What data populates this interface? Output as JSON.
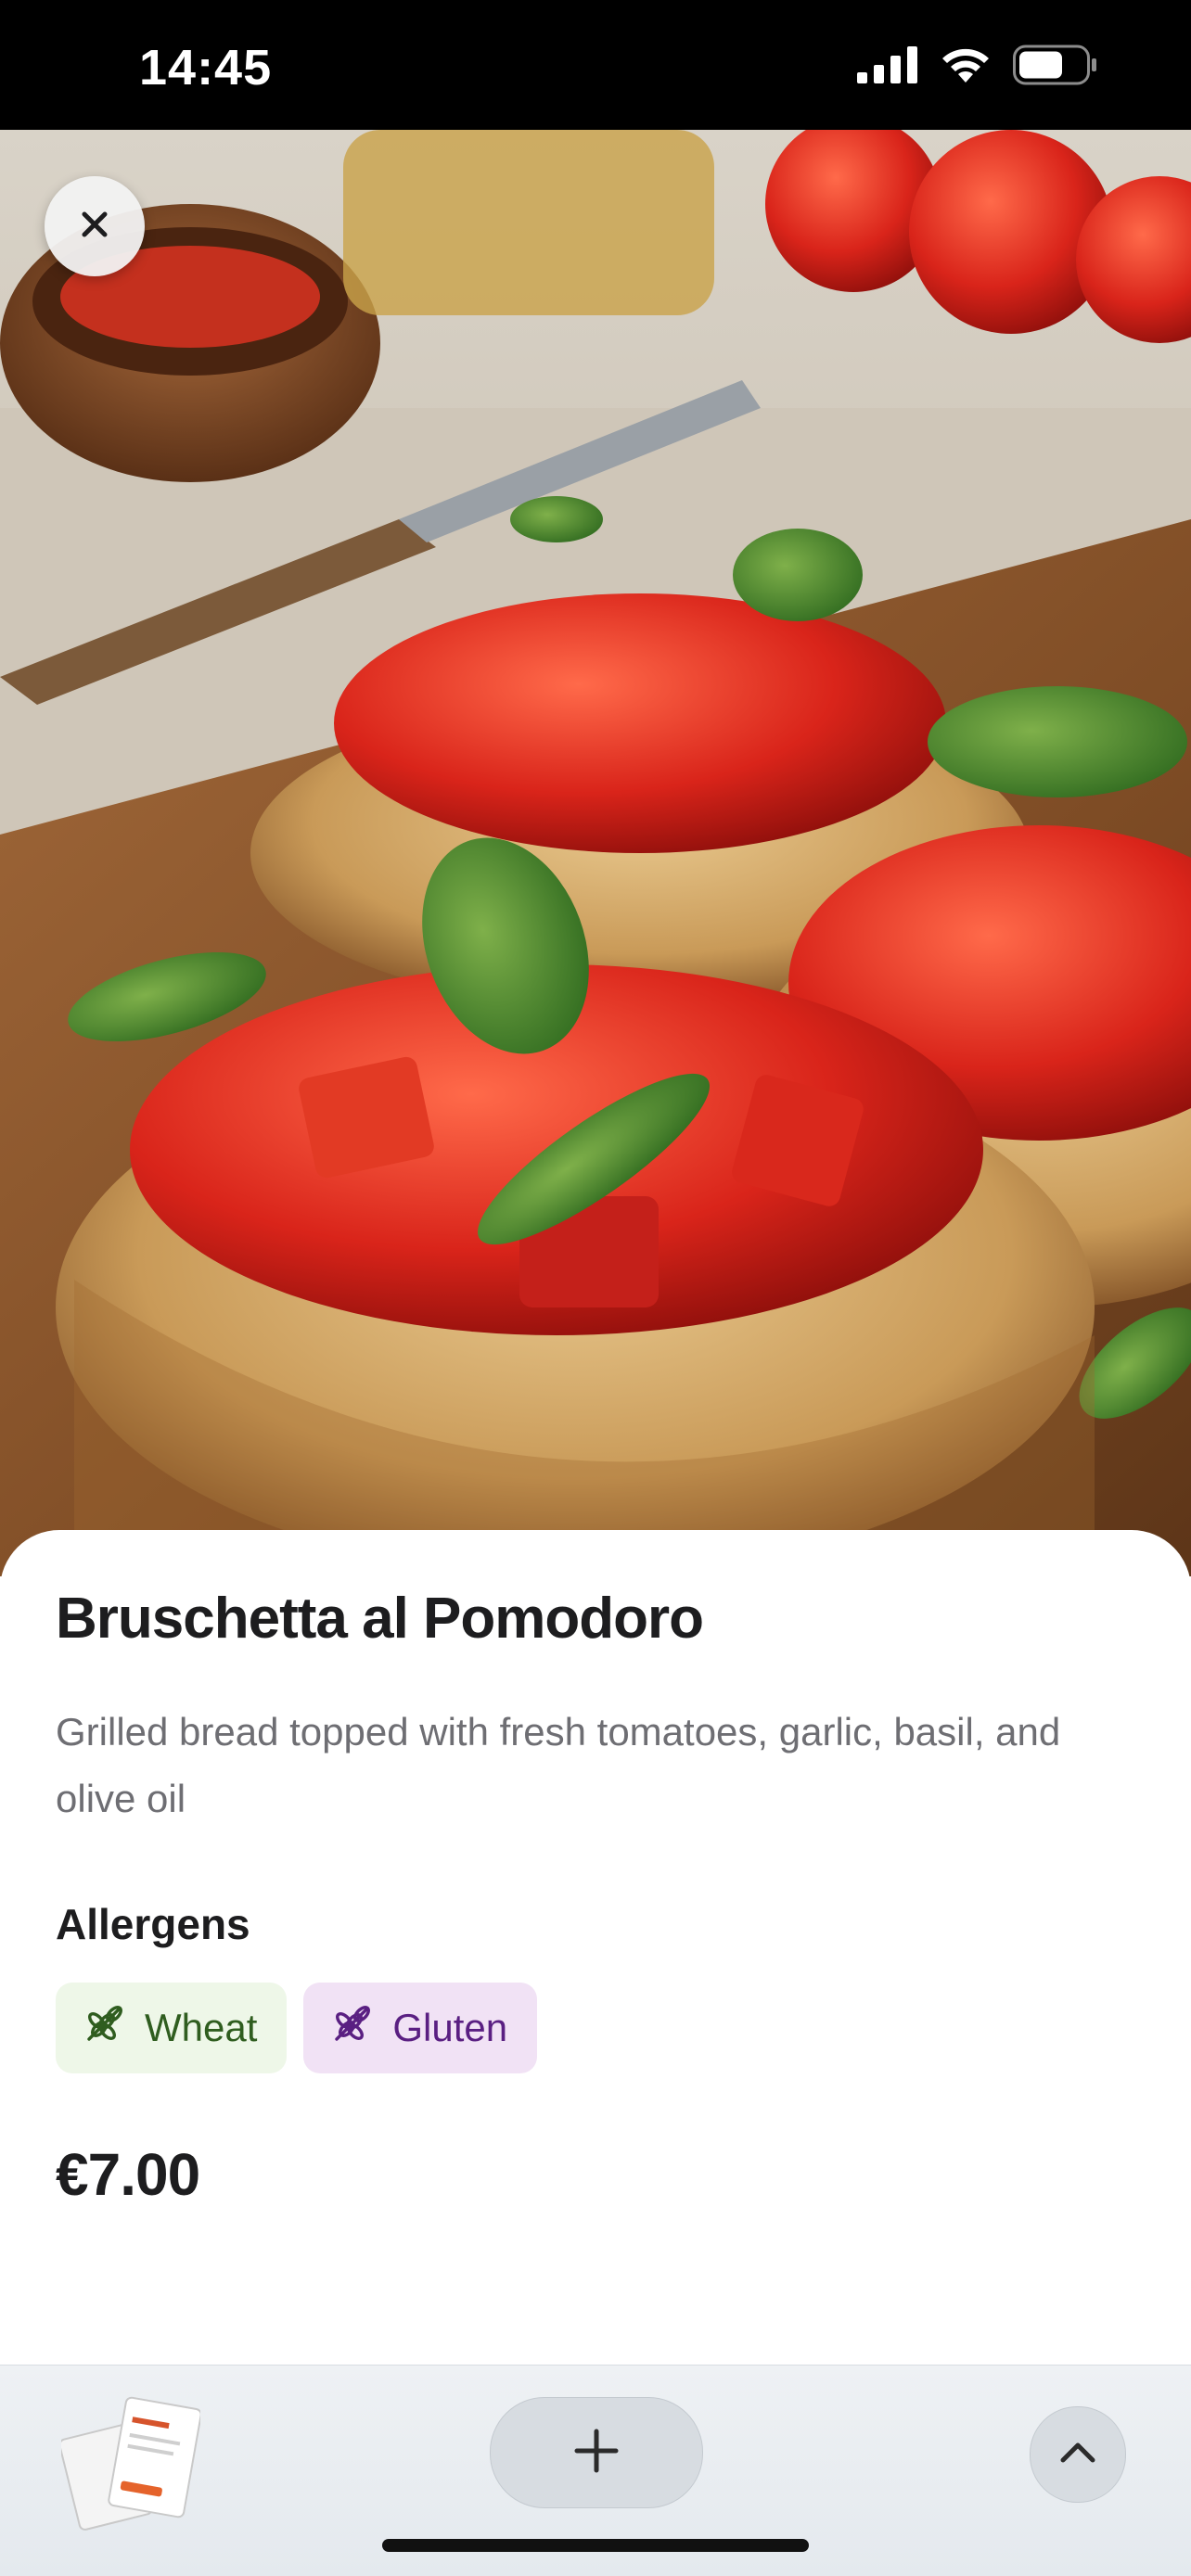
{
  "status_bar": {
    "time": "14:45",
    "icons": [
      "cellular-signal-icon",
      "wifi-icon",
      "battery-icon"
    ]
  },
  "hero": {
    "image": "bruschetta-photo",
    "close_icon": "close-icon"
  },
  "dish": {
    "title": "Bruschetta al Pomodoro",
    "description": "Grilled bread topped with fresh tomatoes, garlic, basil, and olive oil",
    "allergens_heading": "Allergens",
    "allergens": [
      {
        "label": "Wheat",
        "icon": "wheat-icon",
        "bg": "#eef7e8",
        "fg": "#2f5d1f"
      },
      {
        "label": "Gluten",
        "icon": "wheat-icon",
        "bg": "#f1e2f5",
        "fg": "#5a1f82"
      }
    ],
    "price": "€7.00"
  },
  "toolbar": {
    "tabs_icon": "tabs-thumbnail-icon",
    "add_icon": "plus-icon",
    "up_icon": "chevron-up-icon"
  },
  "colors": {
    "title": "#1d1d1f",
    "secondary_text": "#6e6e73",
    "toolbar_bg": "#eef1f4"
  }
}
